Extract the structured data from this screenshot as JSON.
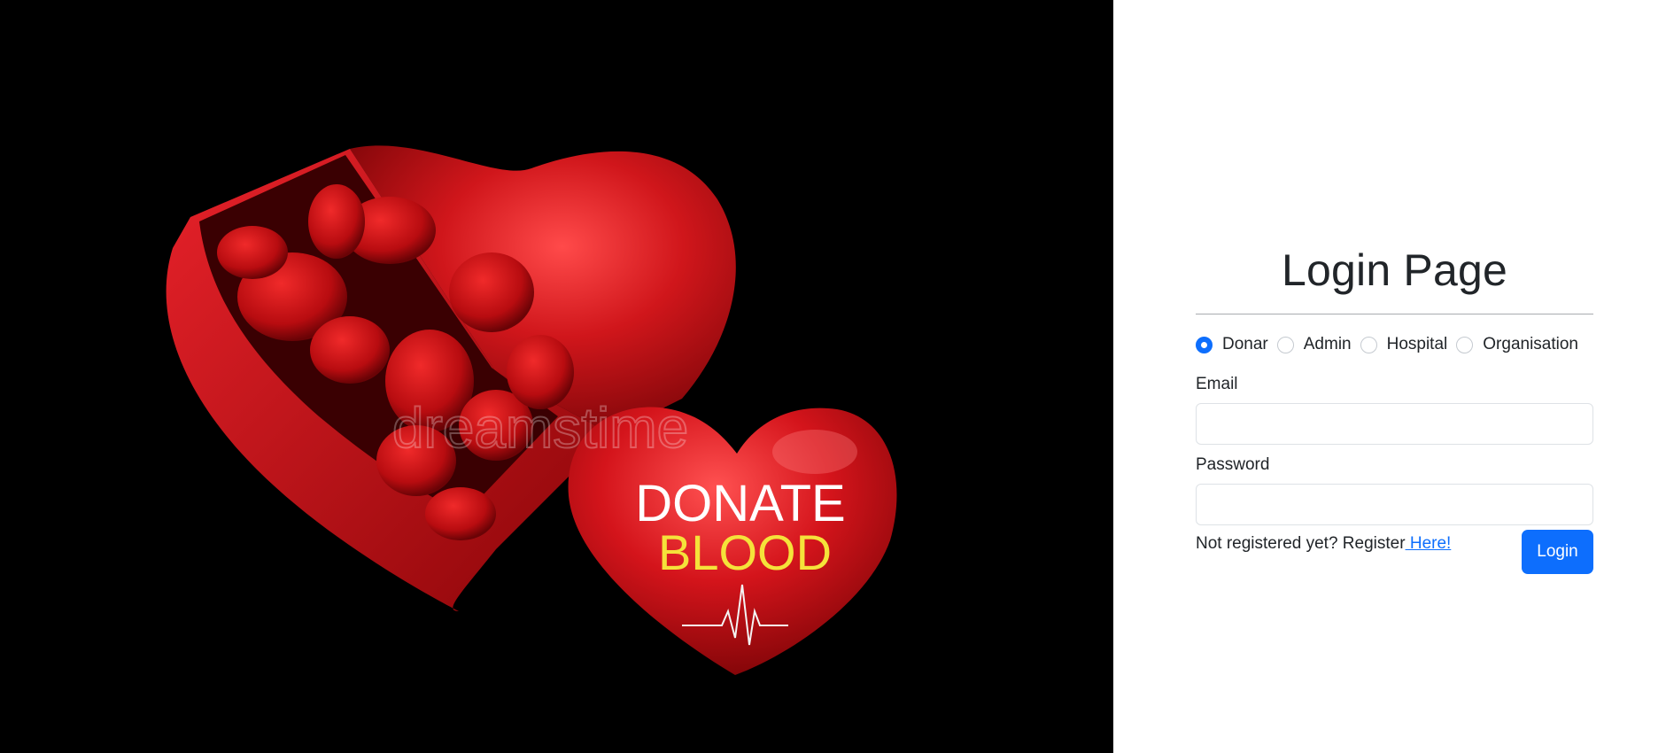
{
  "hero": {
    "caption_line1": "DONATE",
    "caption_line2": "BLOOD",
    "watermark": "dreamstime",
    "colors": {
      "background": "#000000",
      "heart": "#d0161b",
      "caption_white": "#ffffff",
      "caption_yellow": "#f5e23a"
    }
  },
  "login": {
    "title": "Login Page",
    "roles": [
      {
        "label": "Donar",
        "selected": true
      },
      {
        "label": "Admin",
        "selected": false
      },
      {
        "label": "Hospital",
        "selected": false
      },
      {
        "label": "Organisation",
        "selected": false
      }
    ],
    "email_label": "Email",
    "email_value": "",
    "password_label": "Password",
    "password_value": "",
    "register_text": "Not registered yet? Register",
    "register_link": " Here!",
    "login_button": "Login",
    "accent": "#0d6efd"
  }
}
